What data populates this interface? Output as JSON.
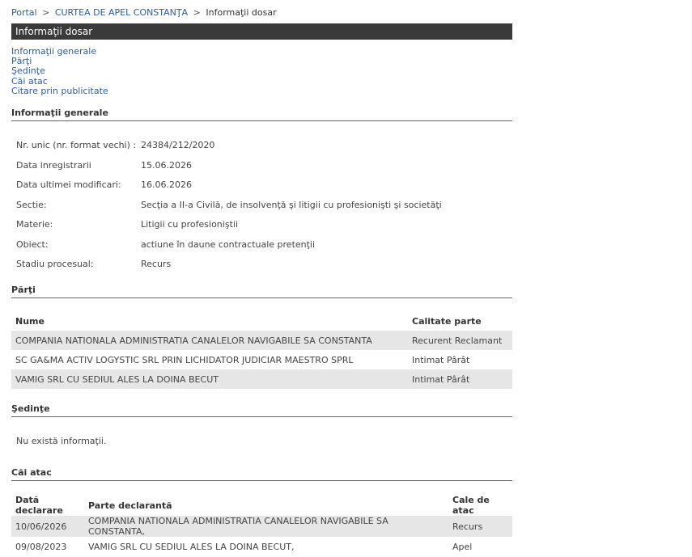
{
  "breadcrumb": {
    "items": [
      "Portal",
      "CURTEA DE APEL CONSTANŢA"
    ],
    "current": "Informaţii dosar",
    "separator": ">"
  },
  "header": {
    "title": "Informaţii dosar"
  },
  "nav": {
    "links": [
      "Informaţii generale",
      "Părţi",
      "Şedinţe",
      "Căi atac",
      "Citare prin publicitate"
    ]
  },
  "general": {
    "title": "Informaţii generale",
    "rows": [
      {
        "label": "Nr. unic (nr. format vechi) :",
        "value": "24384/212/2020"
      },
      {
        "label": "Data inregistrarii",
        "value": "15.06.2026"
      },
      {
        "label": "Data ultimei modificari:",
        "value": "16.06.2026"
      },
      {
        "label": "Sectie:",
        "value": "Secţia a II-a Civilă, de insolvenţă şi litigii cu profesionişti şi societăţi"
      },
      {
        "label": "Materie:",
        "value": "Litigii cu profesioniştii"
      },
      {
        "label": "Obiect:",
        "value": "actiune în daune contractuale pretenţii"
      },
      {
        "label": "Stadiu procesual:",
        "value": "Recurs"
      }
    ]
  },
  "parti": {
    "title": "Părţi",
    "headers": [
      "Nume",
      "Calitate parte"
    ],
    "rows": [
      [
        "COMPANIA NATIONALA ADMINISTRATIA CANALELOR NAVIGABILE SA CONSTANTA",
        "Recurent Reclamant"
      ],
      [
        "SC GA&MA ACTIV LOGYSTIC SRL PRIN LICHIDATOR JUDICIAR MAESTRO SPRL",
        "Intimat Pârât"
      ],
      [
        "VAMIG SRL CU SEDIUL ALES LA DOINA BECUT",
        "Intimat Pârât"
      ]
    ]
  },
  "sedinte": {
    "title": "Şedinţe",
    "empty_text": "Nu există informaţii."
  },
  "cai_atac": {
    "title": "Căi atac",
    "headers": [
      "Dată declarare",
      "Parte declarantă",
      "Cale de atac"
    ],
    "rows": [
      [
        "10/06/2026",
        "COMPANIA NATIONALA ADMINISTRATIA CANALELOR NAVIGABILE SA CONSTANTA,",
        "Recurs"
      ],
      [
        "09/08/2023",
        "VAMIG SRL CU SEDIUL ALES LA DOINA BECUT,",
        "Apel"
      ]
    ]
  },
  "colors": {
    "link": "#2a5d9e",
    "header_bar": "#3a3a3a",
    "row_stripe": "#e6e6e6"
  }
}
